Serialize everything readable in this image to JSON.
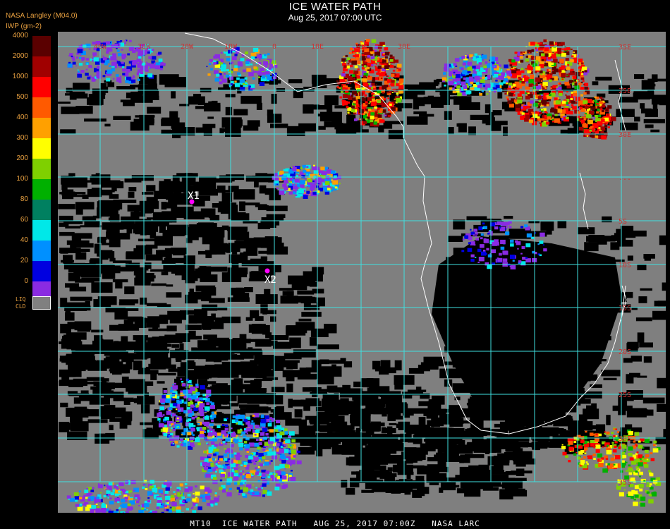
{
  "header": {
    "title": "ICE WATER PATH",
    "subtitle": "Aug 25, 2017 07:00 UTC",
    "org": "NASA Langley (M04.0)",
    "unit": "IWP (gm-2)"
  },
  "legend": {
    "labels": [
      "4000",
      "2000",
      "1000",
      "500",
      "400",
      "300",
      "200",
      "100",
      "80",
      "60",
      "40",
      "20",
      "0"
    ],
    "colors": [
      "#5a0000",
      "#a00000",
      "#ff0000",
      "#ff5a00",
      "#ffa000",
      "#ffff00",
      "#7fd000",
      "#00b000",
      "#008060",
      "#00e8e8",
      "#0090ff",
      "#0000e0",
      "#8a2be2"
    ],
    "liq_label_1": "LIQ",
    "liq_label_2": "CLD",
    "liq_color": "#808080"
  },
  "map": {
    "lat_labels": [
      "35E",
      "25E",
      "30E",
      "...",
      "5S",
      "10S",
      "15S",
      "20S",
      "25S",
      "30S",
      "35S",
      "40S"
    ],
    "lon_labels": [
      "40W",
      "30W",
      "20W",
      "10W",
      "0",
      "10E",
      "20E",
      "30E"
    ],
    "markers": [
      {
        "label": "X1",
        "lon": -22.8,
        "lat": 7.7
      },
      {
        "label": "X2",
        "lon": -12.5,
        "lat": -12.0
      }
    ]
  },
  "footer": {
    "text": "MT10  ICE WATER PATH   AUG 25, 2017 07:00Z   NASA LARC"
  }
}
